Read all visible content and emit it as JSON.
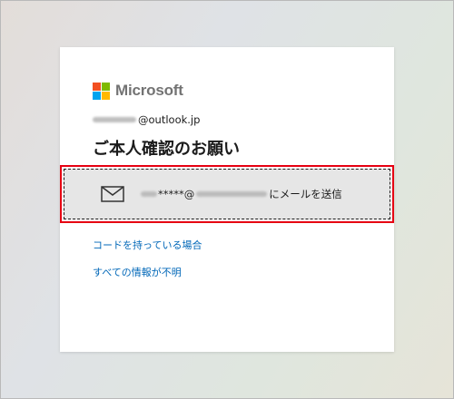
{
  "brand": {
    "name": "Microsoft",
    "colors": [
      "#f25022",
      "#7fba00",
      "#00a4ef",
      "#ffb900"
    ]
  },
  "account": {
    "email_domain": "@outlook.jp"
  },
  "title": "ご本人確認のお願い",
  "option": {
    "icon": "mail-icon",
    "masked_email": "*****@",
    "action_text": "にメールを送信",
    "highlight_color": "#e60012"
  },
  "links": {
    "have_code": "コードを持っている場合",
    "unknown_info": "すべての情報が不明"
  }
}
